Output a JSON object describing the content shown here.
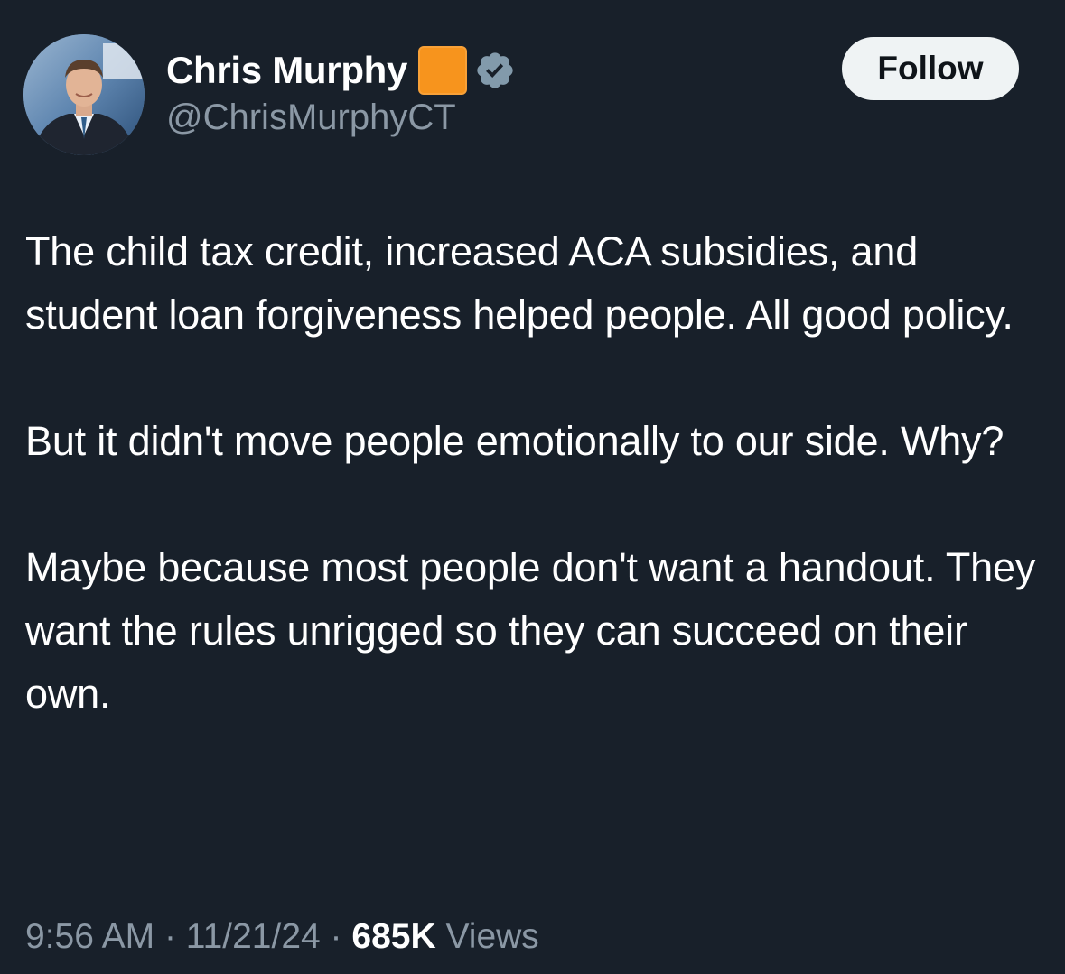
{
  "author": {
    "display_name": "Chris Murphy",
    "handle": "@ChrisMurphyCT",
    "flag_color": "#f7941d",
    "verified_badge_color": "#829aab"
  },
  "actions": {
    "follow_label": "Follow"
  },
  "tweet": {
    "paragraphs": [
      "The child tax credit, increased ACA subsidies, and student loan forgiveness helped people. All good policy.",
      "But it didn't move people emotionally to our side. Why?",
      "Maybe because most people don't want a handout. They want the rules unrigged so they can succeed on their own."
    ]
  },
  "meta": {
    "time": "9:56 AM",
    "separator": "·",
    "date": "11/21/24",
    "views_count": "685K",
    "views_label": "Views"
  },
  "colors": {
    "background": "#18202a",
    "text_primary": "#ffffff",
    "text_secondary": "#8b98a5",
    "button_bg": "#eff3f4"
  }
}
